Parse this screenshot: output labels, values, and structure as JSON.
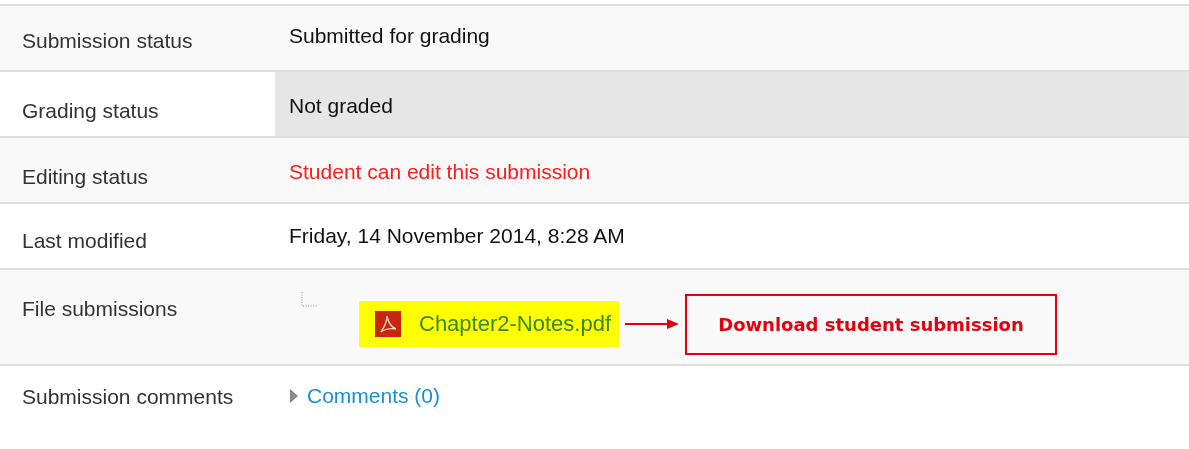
{
  "rows": [
    {
      "label": "Submission status",
      "kind": "text",
      "value": "Submitted for grading",
      "highlighted": false
    },
    {
      "label": "Grading status",
      "kind": "text",
      "value": "Not graded",
      "highlighted": true
    },
    {
      "label": "Editing status",
      "kind": "alert",
      "value": "Student can edit this submission",
      "highlighted": false
    },
    {
      "label": "Last modified",
      "kind": "text",
      "value": "Friday, 14 November 2014, 8:28 AM",
      "highlighted": false
    },
    {
      "label": "File submissions",
      "kind": "file",
      "value": "Chapter2-Notes.pdf",
      "callout": "Download student submission",
      "highlighted": false
    },
    {
      "label": "Submission comments",
      "kind": "comments",
      "value": "Comments (0)",
      "expanded": false,
      "highlighted": false
    }
  ]
}
